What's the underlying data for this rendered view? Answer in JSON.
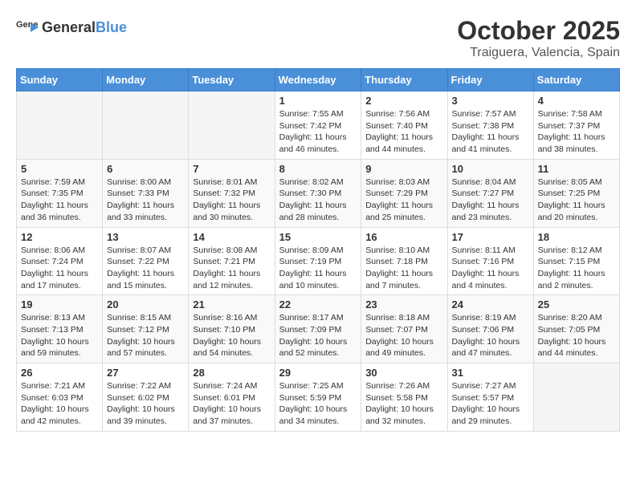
{
  "header": {
    "logo_general": "General",
    "logo_blue": "Blue",
    "month": "October 2025",
    "location": "Traiguera, Valencia, Spain"
  },
  "weekdays": [
    "Sunday",
    "Monday",
    "Tuesday",
    "Wednesday",
    "Thursday",
    "Friday",
    "Saturday"
  ],
  "weeks": [
    [
      {
        "day": "",
        "sunrise": "",
        "sunset": "",
        "daylight": ""
      },
      {
        "day": "",
        "sunrise": "",
        "sunset": "",
        "daylight": ""
      },
      {
        "day": "",
        "sunrise": "",
        "sunset": "",
        "daylight": ""
      },
      {
        "day": "1",
        "sunrise": "Sunrise: 7:55 AM",
        "sunset": "Sunset: 7:42 PM",
        "daylight": "Daylight: 11 hours and 46 minutes."
      },
      {
        "day": "2",
        "sunrise": "Sunrise: 7:56 AM",
        "sunset": "Sunset: 7:40 PM",
        "daylight": "Daylight: 11 hours and 44 minutes."
      },
      {
        "day": "3",
        "sunrise": "Sunrise: 7:57 AM",
        "sunset": "Sunset: 7:38 PM",
        "daylight": "Daylight: 11 hours and 41 minutes."
      },
      {
        "day": "4",
        "sunrise": "Sunrise: 7:58 AM",
        "sunset": "Sunset: 7:37 PM",
        "daylight": "Daylight: 11 hours and 38 minutes."
      }
    ],
    [
      {
        "day": "5",
        "sunrise": "Sunrise: 7:59 AM",
        "sunset": "Sunset: 7:35 PM",
        "daylight": "Daylight: 11 hours and 36 minutes."
      },
      {
        "day": "6",
        "sunrise": "Sunrise: 8:00 AM",
        "sunset": "Sunset: 7:33 PM",
        "daylight": "Daylight: 11 hours and 33 minutes."
      },
      {
        "day": "7",
        "sunrise": "Sunrise: 8:01 AM",
        "sunset": "Sunset: 7:32 PM",
        "daylight": "Daylight: 11 hours and 30 minutes."
      },
      {
        "day": "8",
        "sunrise": "Sunrise: 8:02 AM",
        "sunset": "Sunset: 7:30 PM",
        "daylight": "Daylight: 11 hours and 28 minutes."
      },
      {
        "day": "9",
        "sunrise": "Sunrise: 8:03 AM",
        "sunset": "Sunset: 7:29 PM",
        "daylight": "Daylight: 11 hours and 25 minutes."
      },
      {
        "day": "10",
        "sunrise": "Sunrise: 8:04 AM",
        "sunset": "Sunset: 7:27 PM",
        "daylight": "Daylight: 11 hours and 23 minutes."
      },
      {
        "day": "11",
        "sunrise": "Sunrise: 8:05 AM",
        "sunset": "Sunset: 7:25 PM",
        "daylight": "Daylight: 11 hours and 20 minutes."
      }
    ],
    [
      {
        "day": "12",
        "sunrise": "Sunrise: 8:06 AM",
        "sunset": "Sunset: 7:24 PM",
        "daylight": "Daylight: 11 hours and 17 minutes."
      },
      {
        "day": "13",
        "sunrise": "Sunrise: 8:07 AM",
        "sunset": "Sunset: 7:22 PM",
        "daylight": "Daylight: 11 hours and 15 minutes."
      },
      {
        "day": "14",
        "sunrise": "Sunrise: 8:08 AM",
        "sunset": "Sunset: 7:21 PM",
        "daylight": "Daylight: 11 hours and 12 minutes."
      },
      {
        "day": "15",
        "sunrise": "Sunrise: 8:09 AM",
        "sunset": "Sunset: 7:19 PM",
        "daylight": "Daylight: 11 hours and 10 minutes."
      },
      {
        "day": "16",
        "sunrise": "Sunrise: 8:10 AM",
        "sunset": "Sunset: 7:18 PM",
        "daylight": "Daylight: 11 hours and 7 minutes."
      },
      {
        "day": "17",
        "sunrise": "Sunrise: 8:11 AM",
        "sunset": "Sunset: 7:16 PM",
        "daylight": "Daylight: 11 hours and 4 minutes."
      },
      {
        "day": "18",
        "sunrise": "Sunrise: 8:12 AM",
        "sunset": "Sunset: 7:15 PM",
        "daylight": "Daylight: 11 hours and 2 minutes."
      }
    ],
    [
      {
        "day": "19",
        "sunrise": "Sunrise: 8:13 AM",
        "sunset": "Sunset: 7:13 PM",
        "daylight": "Daylight: 10 hours and 59 minutes."
      },
      {
        "day": "20",
        "sunrise": "Sunrise: 8:15 AM",
        "sunset": "Sunset: 7:12 PM",
        "daylight": "Daylight: 10 hours and 57 minutes."
      },
      {
        "day": "21",
        "sunrise": "Sunrise: 8:16 AM",
        "sunset": "Sunset: 7:10 PM",
        "daylight": "Daylight: 10 hours and 54 minutes."
      },
      {
        "day": "22",
        "sunrise": "Sunrise: 8:17 AM",
        "sunset": "Sunset: 7:09 PM",
        "daylight": "Daylight: 10 hours and 52 minutes."
      },
      {
        "day": "23",
        "sunrise": "Sunrise: 8:18 AM",
        "sunset": "Sunset: 7:07 PM",
        "daylight": "Daylight: 10 hours and 49 minutes."
      },
      {
        "day": "24",
        "sunrise": "Sunrise: 8:19 AM",
        "sunset": "Sunset: 7:06 PM",
        "daylight": "Daylight: 10 hours and 47 minutes."
      },
      {
        "day": "25",
        "sunrise": "Sunrise: 8:20 AM",
        "sunset": "Sunset: 7:05 PM",
        "daylight": "Daylight: 10 hours and 44 minutes."
      }
    ],
    [
      {
        "day": "26",
        "sunrise": "Sunrise: 7:21 AM",
        "sunset": "Sunset: 6:03 PM",
        "daylight": "Daylight: 10 hours and 42 minutes."
      },
      {
        "day": "27",
        "sunrise": "Sunrise: 7:22 AM",
        "sunset": "Sunset: 6:02 PM",
        "daylight": "Daylight: 10 hours and 39 minutes."
      },
      {
        "day": "28",
        "sunrise": "Sunrise: 7:24 AM",
        "sunset": "Sunset: 6:01 PM",
        "daylight": "Daylight: 10 hours and 37 minutes."
      },
      {
        "day": "29",
        "sunrise": "Sunrise: 7:25 AM",
        "sunset": "Sunset: 5:59 PM",
        "daylight": "Daylight: 10 hours and 34 minutes."
      },
      {
        "day": "30",
        "sunrise": "Sunrise: 7:26 AM",
        "sunset": "Sunset: 5:58 PM",
        "daylight": "Daylight: 10 hours and 32 minutes."
      },
      {
        "day": "31",
        "sunrise": "Sunrise: 7:27 AM",
        "sunset": "Sunset: 5:57 PM",
        "daylight": "Daylight: 10 hours and 29 minutes."
      },
      {
        "day": "",
        "sunrise": "",
        "sunset": "",
        "daylight": ""
      }
    ]
  ]
}
